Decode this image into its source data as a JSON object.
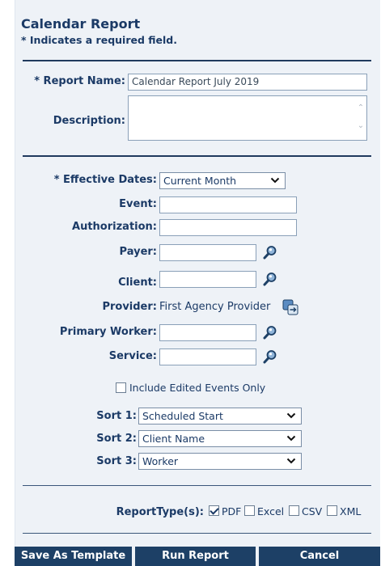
{
  "header": {
    "title": "Calendar Report",
    "required_note": "* Indicates a required field."
  },
  "fields": {
    "report_name_label": "* Report Name:",
    "report_name_value": "Calendar Report July 2019",
    "description_label": "Description:",
    "effective_dates_label": "* Effective Dates:",
    "effective_dates_value": "Current Month",
    "event_label": "Event:",
    "authorization_label": "Authorization:",
    "payer_label": "Payer:",
    "client_label": "Client:",
    "provider_label": "Provider:",
    "provider_value": "First Agency Provider",
    "primary_worker_label": "Primary Worker:",
    "service_label": "Service:",
    "include_edited_label": "Include Edited Events Only",
    "include_edited_checked": false
  },
  "sorts": {
    "sort1_label": "Sort 1:",
    "sort1_value": "Scheduled Start",
    "sort2_label": "Sort 2:",
    "sort2_value": "Client Name",
    "sort3_label": "Sort 3:",
    "sort3_value": "Worker"
  },
  "report_types": {
    "label": "ReportType(s):",
    "pdf_label": "PDF",
    "pdf_checked": true,
    "excel_label": "Excel",
    "excel_checked": false,
    "csv_label": "CSV",
    "csv_checked": false,
    "xml_label": "XML",
    "xml_checked": false
  },
  "buttons": {
    "save_template": "Save As Template",
    "run_report": "Run Report",
    "cancel": "Cancel"
  },
  "colors": {
    "accent": "#1d4066",
    "panel_bg": "#eef2f7",
    "text": "#1b3a66"
  }
}
